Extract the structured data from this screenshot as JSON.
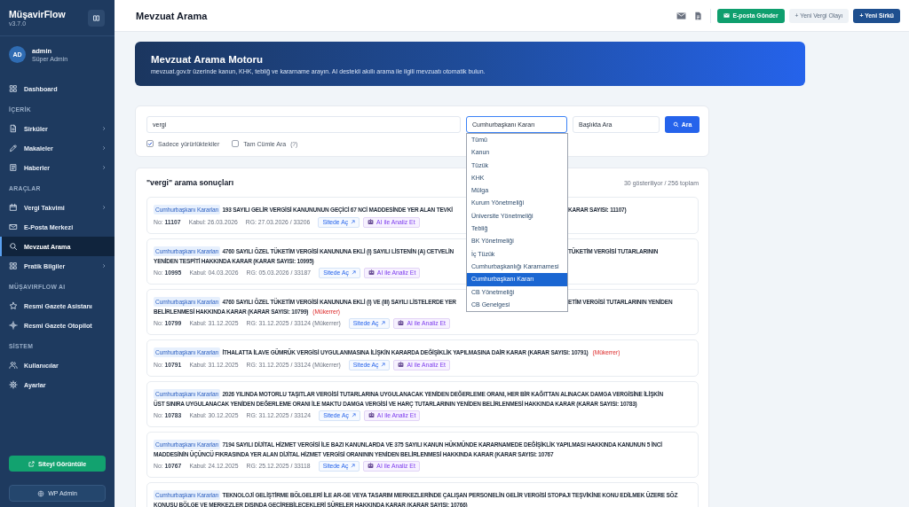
{
  "sidebar": {
    "brand": "MüşavirFlow",
    "version": "v3.7.0",
    "user": {
      "initials": "AD",
      "name": "admin",
      "role": "Süper Admin"
    },
    "sections": [
      {
        "items": [
          {
            "label": "Dashboard",
            "selected": false,
            "has_submenu": false
          }
        ]
      },
      {
        "heading": "İÇERİK",
        "items": [
          {
            "label": "Sirküler",
            "selected": false,
            "has_submenu": true
          },
          {
            "label": "Makaleler",
            "selected": false,
            "has_submenu": true
          },
          {
            "label": "Haberler",
            "selected": false,
            "has_submenu": true
          }
        ]
      },
      {
        "heading": "ARAÇLAR",
        "items": [
          {
            "label": "Vergi Takvimi",
            "selected": false,
            "has_submenu": true
          },
          {
            "label": "E-Posta Merkezi",
            "selected": false,
            "has_submenu": false
          },
          {
            "label": "Mevzuat Arama",
            "selected": true,
            "has_submenu": false
          },
          {
            "label": "Pratik Bilgiler",
            "selected": false,
            "has_submenu": true
          }
        ]
      },
      {
        "heading": "MÜŞAVIRFLOW AI",
        "items": [
          {
            "label": "Resmi Gazete Asistanı",
            "selected": false,
            "has_submenu": false
          },
          {
            "label": "Resmi Gazete Otopilot",
            "selected": false,
            "has_submenu": false
          }
        ]
      },
      {
        "heading": "SİSTEM",
        "items": [
          {
            "label": "Kullanıcılar",
            "selected": false,
            "has_submenu": false
          },
          {
            "label": "Ayarlar",
            "selected": false,
            "has_submenu": false
          }
        ]
      }
    ],
    "footer_buttons": [
      {
        "label": "Siteyi Görüntüle",
        "kind": "primary"
      },
      {
        "label": "WP Admin",
        "kind": "secondary"
      }
    ]
  },
  "topbar": {
    "title": "Mevzuat Arama",
    "actions": [
      {
        "label": "E-posta Gönder",
        "kind": "success"
      },
      {
        "label": "+ Yeni Vergi Olayı",
        "kind": "light"
      },
      {
        "label": "+ Yeni Sirkü",
        "kind": "primary"
      }
    ]
  },
  "banner": {
    "title": "Mevzuat Arama Motoru",
    "subtitle": "mevzuat.gov.tr üzerinde kanun, KHK, tebliğ ve kararname arayın. AI destekli akıllı arama ile ilgili mevzuatı otomatik bulun."
  },
  "search": {
    "query": "vergi",
    "type_select": {
      "value": "Cumhurbaşkanı Kararı",
      "expanded": true,
      "options": [
        {
          "label": "Tümü",
          "selected": false
        },
        {
          "label": "Kanun",
          "selected": false
        },
        {
          "label": "Tüzük",
          "selected": false
        },
        {
          "label": "KHK",
          "selected": false
        },
        {
          "label": "Mülga",
          "selected": false
        },
        {
          "label": "Kurum Yönetmeliği",
          "selected": false
        },
        {
          "label": "Üniversite Yönetmeliği",
          "selected": false
        },
        {
          "label": "Tebliğ",
          "selected": false
        },
        {
          "label": "BK Yönetmeliği",
          "selected": false
        },
        {
          "label": "İç Tüzük",
          "selected": false
        },
        {
          "label": "Cumhurbaşkanlığı Kararnamesi",
          "selected": false
        },
        {
          "label": "Cumhurbaşkanı Kararı",
          "selected": true
        },
        {
          "label": "CB Yönetmeliği",
          "selected": false
        },
        {
          "label": "CB Genelgesi",
          "selected": false
        }
      ]
    },
    "scope_select": {
      "value": "Başlıkta Ara"
    },
    "button": "Ara",
    "options": [
      {
        "label": "Sadece yürürlüktekiler",
        "checked": true
      },
      {
        "label": "Tam Cümle Ara",
        "checked": false,
        "hint": "(?)"
      }
    ]
  },
  "results": {
    "heading": "\"vergi\" arama sonuçları",
    "count": "30 gösteriliyor / 256 toplam",
    "items": [
      {
        "badge": "Cumhurbaşkanı Kararları",
        "title_lines": [
          [
            "193 SAYILI GELİR VERGİSİ KANUNUNUN GEÇİCİ 67 NCİ MADDESİNDE YER ALAN TEVKİ",
            "KARAR SAYISI: 11107)"
          ]
        ],
        "no": "No: **11107**",
        "kabul": "Kabul: 26.03.2026",
        "rg": "RG: 27.03.2026 / 33206",
        "actions": [
          {
            "label": "Sitede Aç",
            "kind": "link"
          },
          {
            "label": "AI ile Analiz Et",
            "kind": "ai"
          }
        ]
      },
      {
        "badge": "Cumhurbaşkanı Kararları",
        "title_lines": [
          [
            "4760 SAYILI ÖZEL TÜKETİM VERGİSİ KANUNUNA EKLİ (I) SAYILI LİSTENİN (A) CETVELİN",
            "TÜKETİM VERGİSİ TUTARLARININ"
          ],
          [
            "YENİDEN TESPİTİ HAKKINDA KARAR (KARAR SAYISI: 10995)"
          ]
        ],
        "no": "No: **10995**",
        "kabul": "Kabul: 04.03.2026",
        "rg": "RG: 05.03.2026 / 33187",
        "actions": [
          {
            "label": "Sitede Aç",
            "kind": "link"
          },
          {
            "label": "AI ile Analiz Et",
            "kind": "ai"
          }
        ]
      },
      {
        "badge": "Cumhurbaşkanı Kararları",
        "title_lines": [
          [
            "4760 SAYILI ÖZEL TÜKETİM VERGİSİ KANUNUNA EKLİ (I) VE (III) SAYILI LİSTELERDE YER",
            "ETİM VERGİSİ TUTARLARININ YENİDEN"
          ],
          [
            "BELİRLENMESİ HAKKINDA KARAR (KARAR SAYISI: 10799)"
          ]
        ],
        "note": "(Mükerrer)",
        "no": "No: **10799**",
        "kabul": "Kabul: 31.12.2025",
        "rg": "RG: 31.12.2025 / 33124 (Mükerrer)",
        "actions": [
          {
            "label": "Sitede Aç",
            "kind": "link"
          },
          {
            "label": "AI ile Analiz Et",
            "kind": "ai"
          }
        ]
      },
      {
        "badge": "Cumhurbaşkanı Kararları",
        "title_lines": [
          [
            "İTHALATTA İLAVE GÜMRÜK VERGİSİ UYGULANMASINA İLİŞKİN KARARDA DEĞİŞİKLİK YAPILMASINA DAİR KARAR (KARAR SAYISI: 10791)"
          ]
        ],
        "note": "(Mükerrer)",
        "no": "No: **10791**",
        "kabul": "Kabul: 31.12.2025",
        "rg": "RG: 31.12.2025 / 33124 (Mükerrer)",
        "actions": [
          {
            "label": "Sitede Aç",
            "kind": "link"
          },
          {
            "label": "AI ile Analiz Et",
            "kind": "ai"
          }
        ]
      },
      {
        "badge": "Cumhurbaşkanı Kararları",
        "title_lines": [
          [
            "2026 YILINDA MOTORLU TAŞITLAR VERGİSİ TUTARLARINA UYGULANACAK YENİDEN DEĞERLEME ORANI, HER BİR KAĞITTAN ALINACAK DAMGA VERGİSİNE İLİŞKİN"
          ],
          [
            "ÜST SINIRA UYGULANACAK YENİDEN DEĞERLEME ORANI İLE MAKTU DAMGA VERGİSİ VE HARÇ TUTARLARININ YENİDEN BELİRLENMESİ HAKKINDA KARAR (KARAR SAYISI: 10783)"
          ]
        ],
        "no": "No: **10783**",
        "kabul": "Kabul: 30.12.2025",
        "rg": "RG: 31.12.2025 / 33124",
        "actions": [
          {
            "label": "Sitede Aç",
            "kind": "link"
          },
          {
            "label": "AI ile Analiz Et",
            "kind": "ai"
          }
        ]
      },
      {
        "badge": "Cumhurbaşkanı Kararları",
        "title_lines": [
          [
            "7194 SAYILI DİJİTAL HİZMET VERGİSİ İLE BAZI KANUNLARDA VE 375 SAYILI KANUN HÜKMÜNDE KARARNAMEDE DEĞİŞİKLİK YAPILMASI HAKKINDA KANUNUN 5 İNCİ"
          ],
          [
            "MADDESİNİN ÜÇÜNCÜ FIKRASINDA YER ALAN DİJİTAL HİZMET VERGİSİ ORANININ YENİDEN BELİRLENMESİ HAKKINDA KARAR (KARAR SAYISI: 10767"
          ]
        ],
        "no": "No: **10767**",
        "kabul": "Kabul: 24.12.2025",
        "rg": "RG: 25.12.2025 / 33118",
        "actions": [
          {
            "label": "Sitede Aç",
            "kind": "link"
          },
          {
            "label": "AI ile Analiz Et",
            "kind": "ai"
          }
        ]
      },
      {
        "badge": "Cumhurbaşkanı Kararları",
        "title_lines": [
          [
            "TEKNOLOJİ GELİŞTİRME BÖLGELERİ İLE AR-GE VEYA TASARIM MERKEZLERİNDE ÇALIŞAN PERSONELİN GELİR VERGİSİ STOPAJI TEŞVİKİNE KONU EDİLMEK ÜZERE SÖZ"
          ],
          [
            "KONUSU BÖLGE VE MERKEZLER DIŞINDA GEÇİREBİLECEKLERİ SÜRELER HAKKINDA KARAR (KARAR SAYISI: 10766)"
          ]
        ]
      }
    ]
  }
}
